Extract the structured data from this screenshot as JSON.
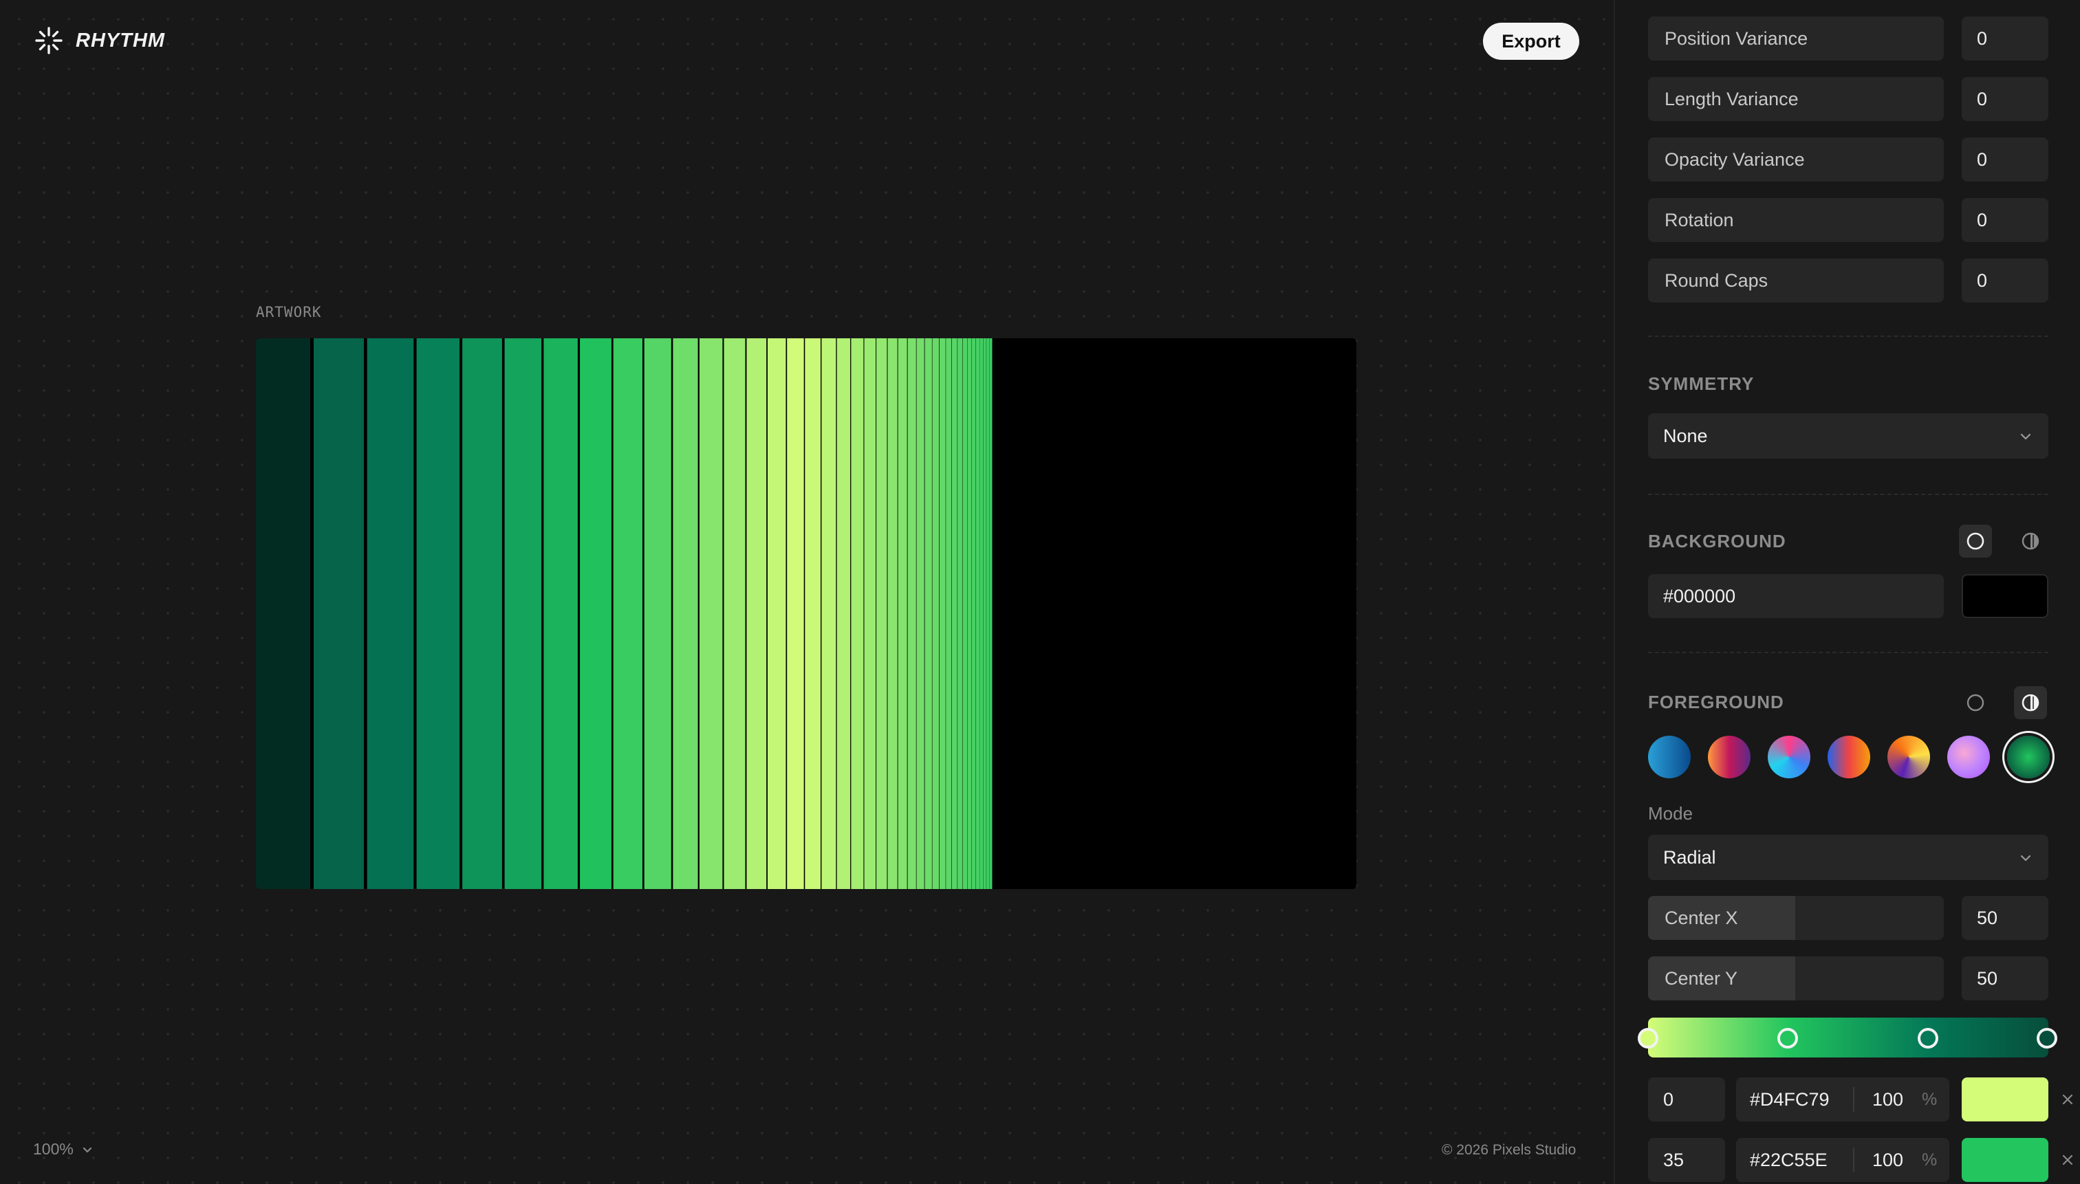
{
  "app": {
    "name": "RHYTHM"
  },
  "toolbar": {
    "export_label": "Export"
  },
  "canvas": {
    "artwork_label": "ARTWORK",
    "zoom": "100%",
    "copyright": "© 2026 Pixels Studio",
    "background_color": "#000000"
  },
  "params": [
    {
      "label": "Position Variance",
      "value": "0"
    },
    {
      "label": "Length Variance",
      "value": "0"
    },
    {
      "label": "Opacity Variance",
      "value": "0"
    },
    {
      "label": "Rotation",
      "value": "0"
    },
    {
      "label": "Round Caps",
      "value": "0"
    }
  ],
  "symmetry": {
    "title": "SYMMETRY",
    "value": "None"
  },
  "background": {
    "title": "BACKGROUND",
    "hex": "#000000",
    "swatch": "#000000",
    "mode_icons": [
      "solid-mode-icon",
      "gradient-mode-icon"
    ],
    "active_mode": "solid"
  },
  "foreground": {
    "title": "FOREGROUND",
    "mode_icons": [
      "solid-mode-icon",
      "gradient-mode-icon"
    ],
    "active_mode": "gradient",
    "presets": [
      {
        "name": "ocean",
        "colors": [
          "#2aa0d8",
          "#0a4a8c"
        ]
      },
      {
        "name": "sunset",
        "colors": [
          "#ff9a3c",
          "#c2185b",
          "#5a2a8a"
        ]
      },
      {
        "name": "prism",
        "colors": [
          "#ff3d8b",
          "#3b82f6",
          "#22d3ee"
        ]
      },
      {
        "name": "spectrum",
        "colors": [
          "#2563eb",
          "#ef4444",
          "#f59e0b"
        ]
      },
      {
        "name": "ember",
        "colors": [
          "#5b21b6",
          "#f97316",
          "#fde047"
        ]
      },
      {
        "name": "bloom",
        "colors": [
          "#f9a8d4",
          "#c084fc",
          "#a855f7"
        ]
      },
      {
        "name": "forest",
        "colors": [
          "#22C55E",
          "#064E3B"
        ],
        "selected": true
      }
    ],
    "mode_label": "Mode",
    "mode_value": "Radial",
    "center_x": {
      "label": "Center X",
      "value": "50"
    },
    "center_y": {
      "label": "Center Y",
      "value": "50"
    },
    "stops": [
      {
        "position": "0",
        "hex": "#D4FC79",
        "opacity": "100",
        "unit": "%"
      },
      {
        "position": "35",
        "hex": "#22C55E",
        "opacity": "100",
        "unit": "%"
      }
    ],
    "gradient_bar": [
      "#D4FC79",
      "#22C55E",
      "#047857",
      "#064E3B"
    ],
    "handle_colors": [
      "#D4FC79",
      "#22C55E",
      "#047857",
      "#064E3B"
    ]
  }
}
